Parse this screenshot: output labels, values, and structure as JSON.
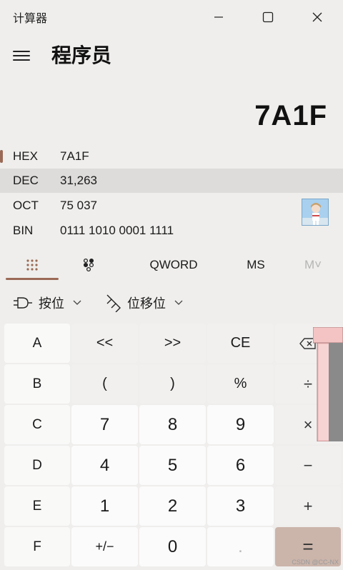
{
  "window": {
    "title": "计算器",
    "minimize_icon": "minimize-icon",
    "maximize_icon": "maximize-icon",
    "close_icon": "close-icon"
  },
  "header": {
    "menu_icon": "hamburger-icon",
    "mode_title": "程序员"
  },
  "display": {
    "value": "7A1F"
  },
  "radix": [
    {
      "label": "HEX",
      "value": "7A1F",
      "selected": false,
      "active": true
    },
    {
      "label": "DEC",
      "value": "31,263",
      "selected": true,
      "active": false
    },
    {
      "label": "OCT",
      "value": "75 037",
      "selected": false,
      "active": false
    },
    {
      "label": "BIN",
      "value": "0111 1010 0001 1111",
      "selected": false,
      "active": false
    }
  ],
  "tabs": {
    "keypad_icon": "full-keypad-icon",
    "bit_toggle_icon": "bit-toggling-keypad-icon",
    "word_size": "QWORD",
    "memory_store": "MS",
    "memory_menu": "M˅"
  },
  "operations": {
    "bitwise_label": "按位",
    "bitshift_label": "位移位"
  },
  "keypad": {
    "rows": [
      [
        "A",
        "<<",
        ">>",
        "CE",
        "⌫"
      ],
      [
        "B",
        "(",
        ")",
        "%",
        "÷"
      ],
      [
        "C",
        "7",
        "8",
        "9",
        "×"
      ],
      [
        "D",
        "4",
        "5",
        "6",
        "−"
      ],
      [
        "E",
        "1",
        "2",
        "3",
        "+"
      ],
      [
        "F",
        "+/−",
        "0",
        ".",
        "="
      ]
    ]
  },
  "colors": {
    "accent": "#9a6a56",
    "equals_bg": "#cbb4aa",
    "window_bg": "#efeeec"
  },
  "watermark": "CSDN @CC-NX"
}
